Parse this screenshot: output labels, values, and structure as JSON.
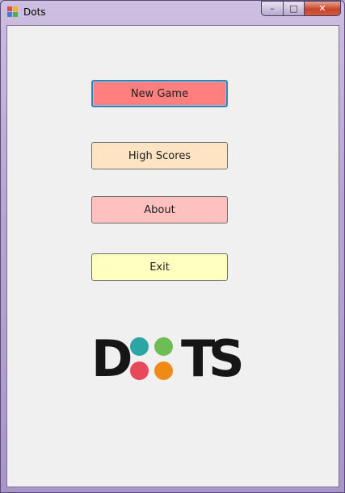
{
  "window": {
    "title": "Dots",
    "controls": {
      "minimize": "–",
      "maximize": "□",
      "close": "✕"
    }
  },
  "menu": {
    "buttons": [
      {
        "label": "New Game",
        "color": "#ff7f7f"
      },
      {
        "label": "High Scores",
        "color": "#ffe4c4"
      },
      {
        "label": "About",
        "color": "#ffc0c0"
      },
      {
        "label": "Exit",
        "color": "#ffffc0"
      }
    ]
  },
  "logo": {
    "letters": [
      "D",
      "T",
      "S"
    ],
    "dots": [
      {
        "name": "teal-dot",
        "color": "#2ca6a4"
      },
      {
        "name": "green-dot",
        "color": "#6dbd55"
      },
      {
        "name": "red-dot",
        "color": "#e8485a"
      },
      {
        "name": "orange-dot",
        "color": "#f08a17"
      }
    ]
  }
}
